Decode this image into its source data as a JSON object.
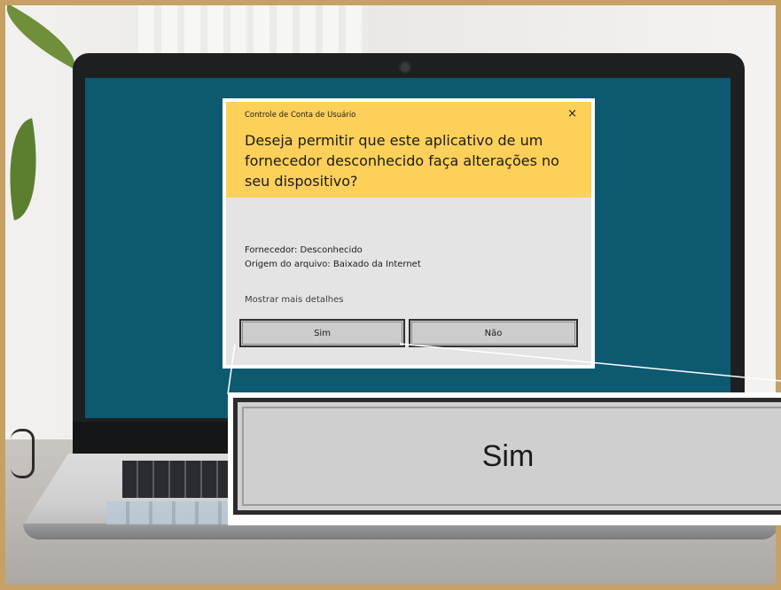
{
  "dialog": {
    "title": "Controle de Conta de Usuário",
    "close_icon": "×",
    "question": "Deseja permitir que este aplicativo de um fornecedor desconhecido faça alterações no seu dispositivo?",
    "publisher": "Fornecedor: Desconhecido",
    "file_origin": "Origem do arquivo: Baixado da Internet",
    "more_details": "Mostrar mais detalhes",
    "yes_label": "Sim",
    "no_label": "Não"
  },
  "zoom": {
    "label": "Sim"
  },
  "colors": {
    "header_yellow": "#fdd05a",
    "screen_teal": "#0d5a70",
    "body_gray": "#e4e4e4",
    "frame_gold": "#c7a064"
  },
  "icons": [
    "close-icon",
    "webcam-icon"
  ]
}
